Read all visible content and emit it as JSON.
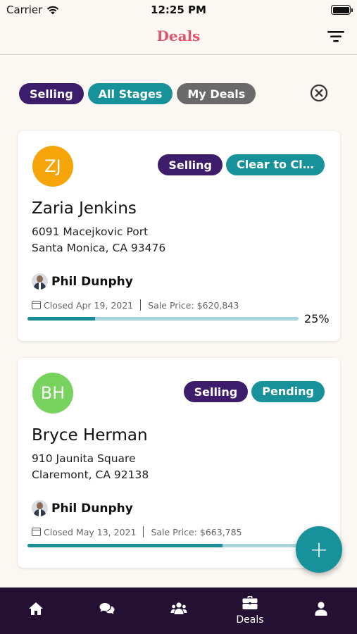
{
  "status_bar": {
    "carrier": "Carrier",
    "time": "12:25 PM"
  },
  "header": {
    "title": "Deals"
  },
  "filters": [
    {
      "label": "Selling",
      "color": "#3d1c6b"
    },
    {
      "label": "All Stages",
      "color": "#17929a"
    },
    {
      "label": "My Deals",
      "color": "#6a6a6a"
    }
  ],
  "deals": [
    {
      "initials": "ZJ",
      "avatar_color": "#f5a50a",
      "side": "Selling",
      "stage": "Clear to Clo...",
      "name": "Zaria Jenkins",
      "address_line1": "6091 Macejkovic Port",
      "address_line2": "Santa Monica, CA 93476",
      "agent": "Phil Dunphy",
      "closed": "Closed Apr 19, 2021",
      "sale_price": "Sale Price: $620,843",
      "progress": 0.25,
      "progress_label": "25%"
    },
    {
      "initials": "BH",
      "avatar_color": "#77d35e",
      "side": "Selling",
      "stage": "Pending",
      "name": "Bryce Herman",
      "address_line1": "910 Jaunita Square",
      "address_line2": "Claremont, CA 92138",
      "agent": "Phil Dunphy",
      "closed": "Closed May 13, 2021",
      "sale_price": "Sale Price: $663,785",
      "progress": 0.72
    }
  ],
  "tabbar": {
    "items": [
      {
        "icon": "home-icon"
      },
      {
        "icon": "chat-icon"
      },
      {
        "icon": "people-icon"
      },
      {
        "icon": "briefcase-icon",
        "label": "Deals",
        "active": true
      },
      {
        "icon": "user-icon"
      }
    ]
  },
  "colors": {
    "accent": "#17929a",
    "brand": "#e0566b",
    "tabbar": "#241033",
    "selling": "#3d1c6b"
  }
}
